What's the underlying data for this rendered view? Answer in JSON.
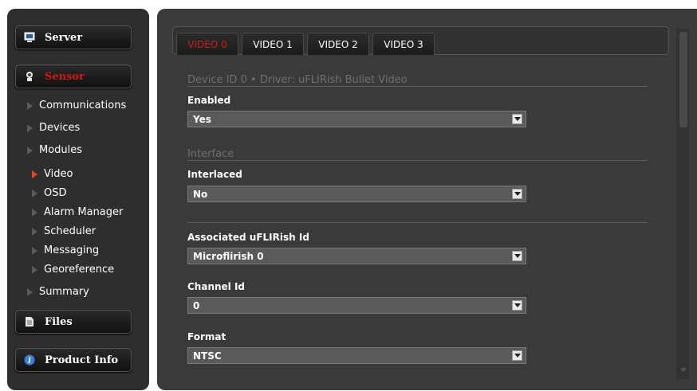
{
  "sidebar": {
    "server": {
      "label": "Server",
      "icon": "server-icon"
    },
    "sensor": {
      "label": "Sensor",
      "icon": "sensor-icon"
    },
    "nav": [
      {
        "label": "Communications"
      },
      {
        "label": "Devices"
      },
      {
        "label": "Modules"
      },
      {
        "label": "Video"
      },
      {
        "label": "OSD"
      },
      {
        "label": "Alarm Manager"
      },
      {
        "label": "Scheduler"
      },
      {
        "label": "Messaging"
      },
      {
        "label": "Georeference"
      },
      {
        "label": "Summary"
      }
    ],
    "files": {
      "label": "Files",
      "icon": "file-icon"
    },
    "product_info": {
      "label": "Product Info",
      "icon": "info-icon"
    }
  },
  "tabs": [
    {
      "label": "VIDEO 0",
      "active": true
    },
    {
      "label": "VIDEO 1"
    },
    {
      "label": "VIDEO 2"
    },
    {
      "label": "VIDEO 3"
    }
  ],
  "main": {
    "device_header": "Device ID 0 • Driver: uFLIRish Bullet Video",
    "interface_header": "Interface",
    "fields": {
      "enabled": {
        "label": "Enabled",
        "value": "Yes"
      },
      "interlaced": {
        "label": "Interlaced",
        "value": "No"
      },
      "associated": {
        "label": "Associated uFLIRish Id",
        "value": "Microflirish 0"
      },
      "channel": {
        "label": "Channel Id",
        "value": "0"
      },
      "format": {
        "label": "Format",
        "value": "NTSC"
      }
    }
  },
  "colors": {
    "accent": "#d01d17",
    "background": "#3a3a3a",
    "sidebar": "#2e2e2e"
  }
}
